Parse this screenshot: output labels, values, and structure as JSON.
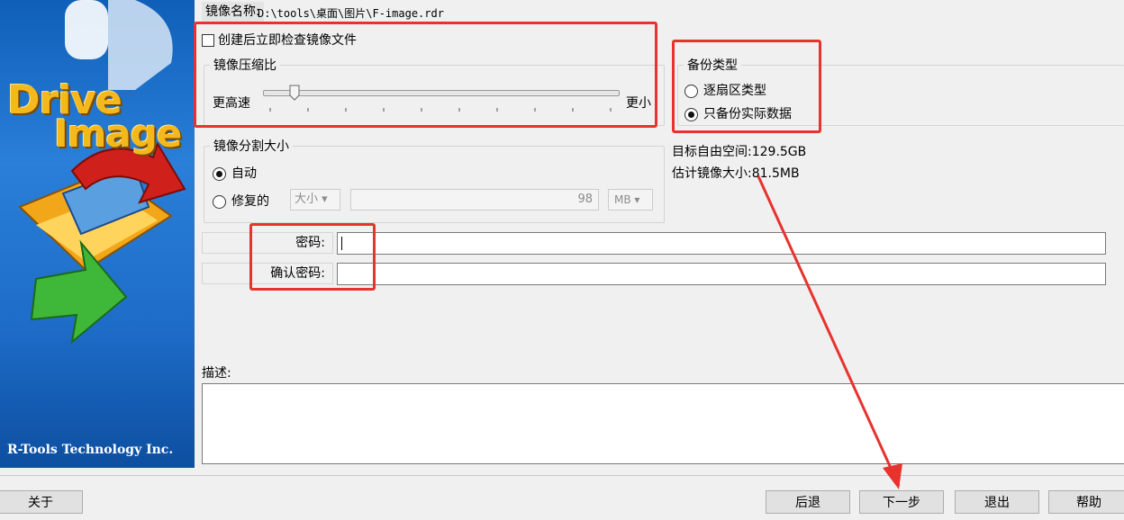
{
  "sidebar": {
    "logo_line1": "Drive",
    "logo_line2": "Image",
    "company": "R-Tools Technology Inc."
  },
  "image_name": {
    "label": "镜像名称:",
    "value": "D:\\tools\\桌面\\图片\\F-image.rdr"
  },
  "verify_checkbox": {
    "label": "创建后立即检查镜像文件",
    "checked": false
  },
  "compression": {
    "legend": "镜像压缩比",
    "left_label": "更高速",
    "right_label": "更小",
    "level": 0.09
  },
  "backup_type": {
    "legend": "备份类型",
    "options": [
      {
        "label": "逐扇区类型",
        "selected": false
      },
      {
        "label": "只备份实际数据",
        "selected": true
      }
    ]
  },
  "space_info": {
    "free_space": "目标自由空间:129.5GB",
    "estimated_size": "估计镜像大小:81.5MB"
  },
  "split": {
    "legend": "镜像分割大小",
    "auto_label": "自动",
    "fixed_label": "修复的",
    "size_select": "大小",
    "size_value": "98",
    "unit_select": "MB"
  },
  "password": {
    "label": "密码:",
    "value": ""
  },
  "confirm_password": {
    "label": "确认密码:",
    "value": ""
  },
  "description": {
    "label": "描述:",
    "value": ""
  },
  "buttons": {
    "about": "关于",
    "back": "后退",
    "next": "下一步",
    "exit": "退出",
    "help": "帮助"
  },
  "colors": {
    "highlight": "#e8322d",
    "sidebar": "#1d6cc8",
    "logo_text": "#f5b81c"
  }
}
